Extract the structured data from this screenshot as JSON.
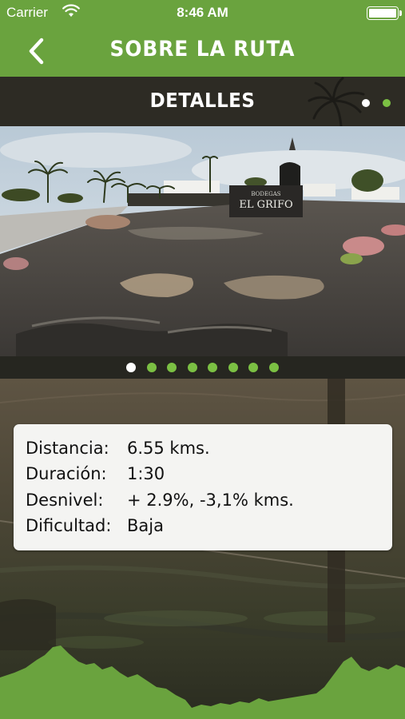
{
  "status_bar": {
    "carrier": "Carrier",
    "time": "8:46 AM",
    "battery_level": 1.0
  },
  "nav": {
    "title": "SOBRE LA RUTA",
    "back_icon": "chevron-left-icon"
  },
  "section": {
    "title": "DETALLES",
    "page_count": 2,
    "active_page": 0
  },
  "gallery": {
    "image_sign_line1": "BODEGAS",
    "image_sign_line2": "EL GRIFO",
    "dot_count": 8,
    "active_index": 0
  },
  "details": {
    "distance_label": "Distancia:",
    "distance_value": "6.55 kms.",
    "duration_label": "Duración:",
    "duration_value": "1:30",
    "elevation_label": "Desnivel:",
    "elevation_value": "+ 2.9%, -3,1% kms.",
    "difficulty_label": "Dificultad:",
    "difficulty_value": "Baja"
  },
  "colors": {
    "brand_green": "#6aa33e",
    "dot_active": "#ffffff",
    "dot_inactive": "#7bc043",
    "dark_bar": "#2d2b24"
  }
}
